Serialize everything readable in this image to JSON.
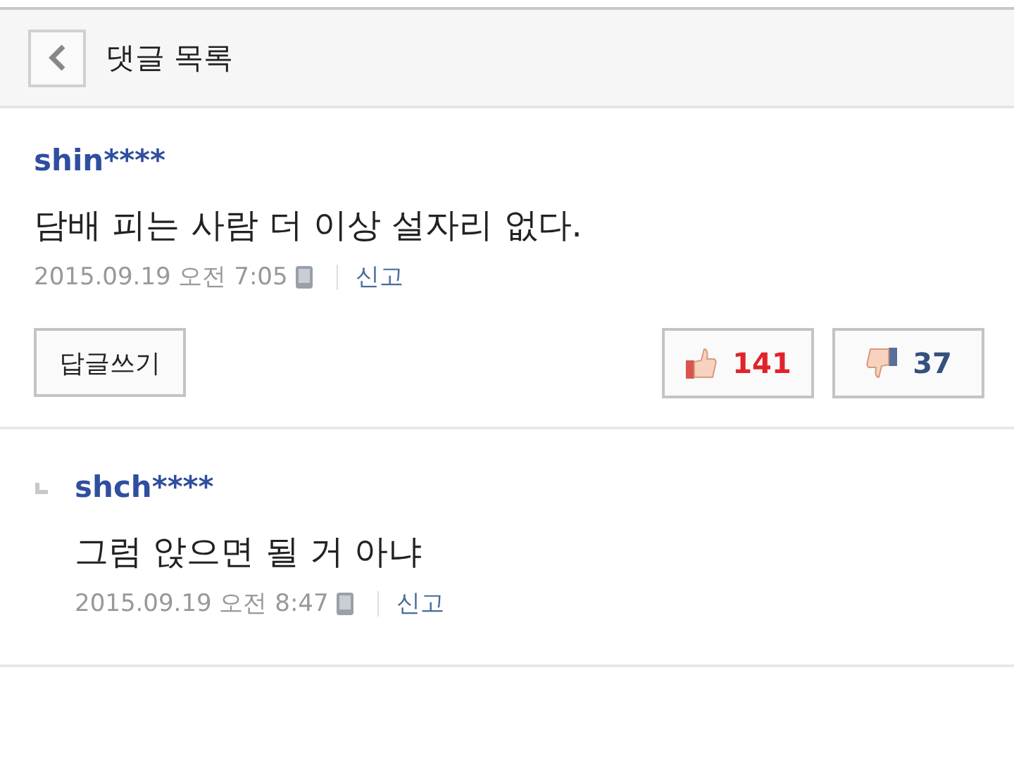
{
  "header": {
    "title": "댓글 목록"
  },
  "comments": [
    {
      "kind": "comment",
      "author": "shin****",
      "text": "담배 피는 사람 더 이상 설자리 없다.",
      "date": "2015.09.19 오전 7:05",
      "report": "신고",
      "reply_button": "답글쓰기",
      "likes": "141",
      "dislikes": "37"
    },
    {
      "kind": "reply",
      "author": "shch****",
      "text": "그럼 앉으면 될 거 아냐",
      "date": "2015.09.19 오전 8:47",
      "report": "신고"
    }
  ]
}
